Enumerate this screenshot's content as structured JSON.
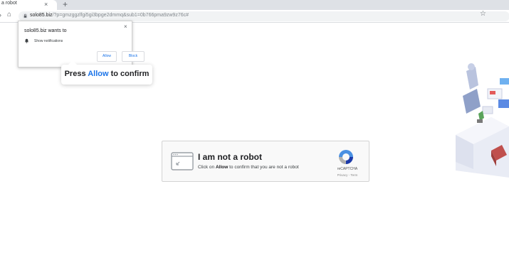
{
  "browser": {
    "tab_title": "a robot",
    "tab_close": "×",
    "new_tab": "+",
    "url_domain": "solo85.biz",
    "url_rest": "/?p=gmzggzlfgi5gi3bpge2dmmq&sub1=0b766pma9zw9z76c#",
    "forward_glyph": "›",
    "home_glyph": "⌂",
    "star_glyph": "☆"
  },
  "permission": {
    "title": "solo85.biz wants to",
    "close": "×",
    "item": "Show notifications",
    "allow_label": "Allow",
    "block_label": "Block"
  },
  "bubble": {
    "prefix": "Press ",
    "highlight": "Allow",
    "suffix": " to confirm"
  },
  "captcha": {
    "title": "I am not a robot",
    "sub_prefix": "Click on ",
    "sub_bold": "Allow",
    "sub_suffix": " to confirm that you are not a robot",
    "brand": "reCAPTCHA",
    "links": "Privacy - Term"
  },
  "colors": {
    "accent": "#1a73e8",
    "tabstrip": "#dee1e6",
    "omnibox": "#f1f3f4",
    "captcha_bg": "#f9f9f9"
  }
}
